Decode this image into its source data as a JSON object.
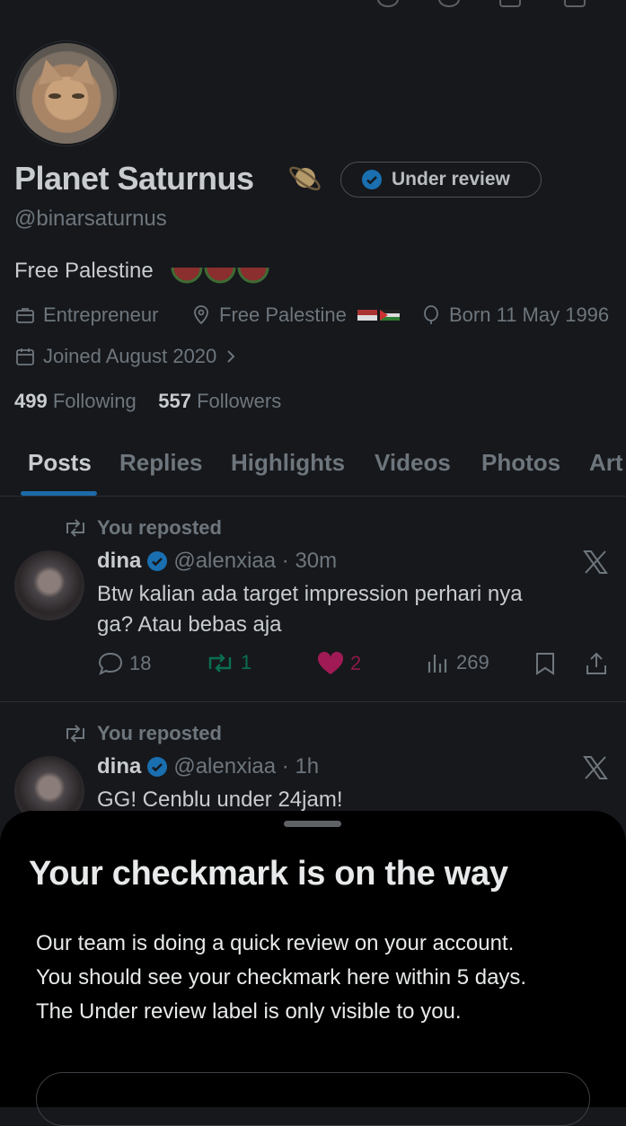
{
  "profile": {
    "name": "Planet Saturnus",
    "name_emoji_icon": "ringed-planet-icon",
    "review_badge": "Under review",
    "handle": "@binarsaturnus",
    "bio": "Free Palestine",
    "meta": {
      "job": "Entrepreneur",
      "location": "Free Palestine",
      "birthday": "Born 11 May 1996",
      "joined": "Joined August 2020"
    },
    "following_count": "499",
    "following_label": "Following",
    "followers_count": "557",
    "followers_label": "Followers"
  },
  "tabs": [
    "Posts",
    "Replies",
    "Highlights",
    "Videos",
    "Photos",
    "Art"
  ],
  "active_tab": "Posts",
  "posts": [
    {
      "repost_label": "You reposted",
      "author": "dina",
      "handle_time": "@alenxiaa · 30m",
      "text_line1": "Btw kalian ada target impression perhari nya",
      "text_line2": "ga? Atau bebas aja",
      "replies": "18",
      "reposts": "1",
      "likes": "2",
      "views": "269"
    },
    {
      "repost_label": "You reposted",
      "author": "dina",
      "handle_time": "@alenxiaa · 1h",
      "text_line1": "GG! Cenblu under 24jam!"
    }
  ],
  "sheet": {
    "title": "Your checkmark is on the way",
    "line1": "Our team is doing a quick review on your account.",
    "line2": "You should see your checkmark here within 5 days.",
    "line3": "The Under review label is only visible to you."
  },
  "colors": {
    "background": "#16181c",
    "sheet": "#000000",
    "verified_blue": "#1d9bf0",
    "repost_green": "#00ba7c",
    "like_pink": "#f91880"
  }
}
